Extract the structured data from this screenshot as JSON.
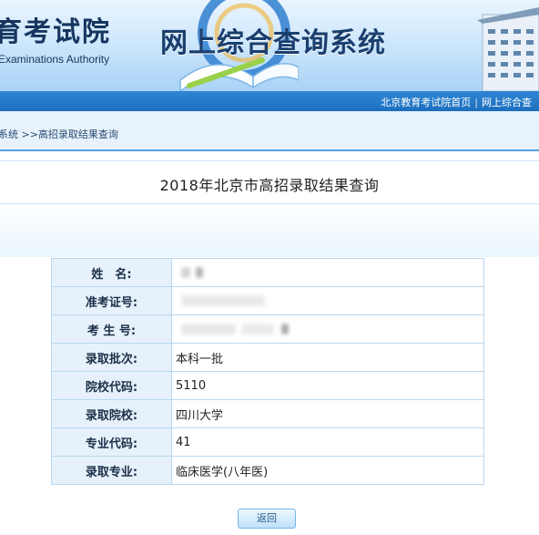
{
  "header": {
    "org_name": "育考试院",
    "org_name_en": "Examinations Authority",
    "system_title": "网上综合查询系统"
  },
  "nav": {
    "link_home": "北京教育考试院首页",
    "separator": "|",
    "link_system": "网上综合查"
  },
  "breadcrumb": "系统 >>高招录取结果查询",
  "page_title": "2018年北京市高招录取结果查询",
  "result": {
    "rows": [
      {
        "label": "姓　名:",
        "value": ""
      },
      {
        "label": "准考证号:",
        "value": ""
      },
      {
        "label": "考 生 号:",
        "value": ""
      },
      {
        "label": "录取批次:",
        "value": "本科一批"
      },
      {
        "label": "院校代码:",
        "value": "5110"
      },
      {
        "label": "录取院校:",
        "value": "四川大学"
      },
      {
        "label": "专业代码:",
        "value": "41"
      },
      {
        "label": "录取专业:",
        "value": "临床医学(八年医)"
      }
    ]
  },
  "back_button": "返回",
  "colors": {
    "nav_blue": "#1e6fbe",
    "table_border": "#b9d7ef",
    "label_bg": "#e6f1fb"
  }
}
